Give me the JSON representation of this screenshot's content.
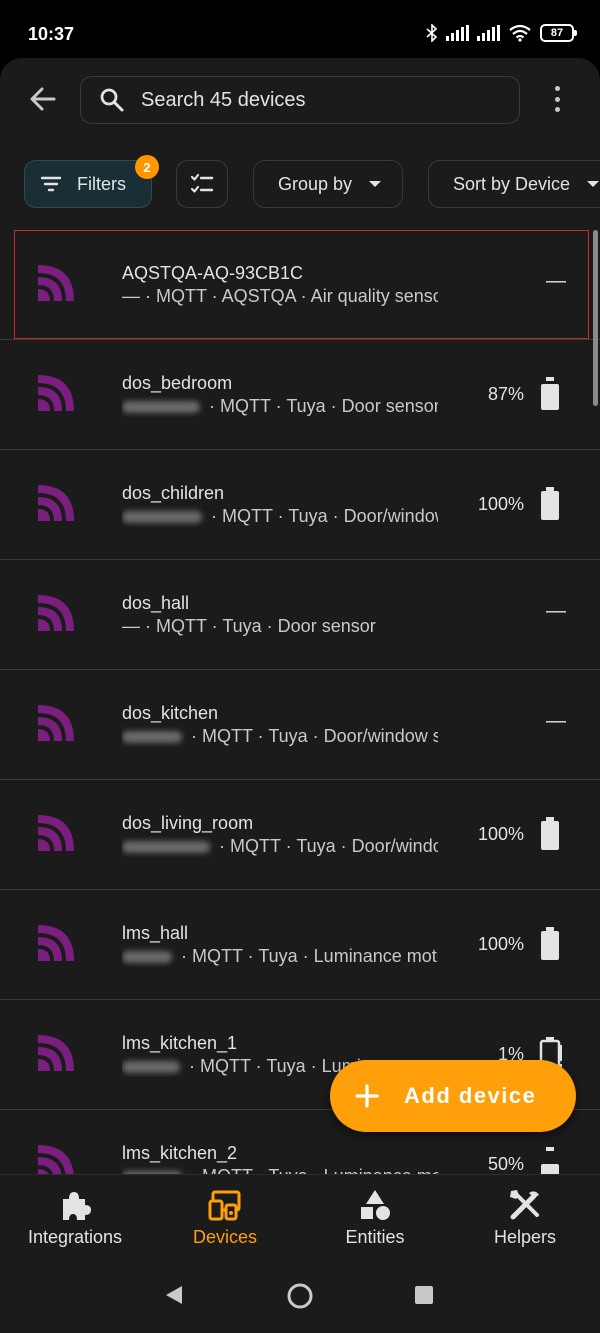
{
  "status_bar": {
    "time": "10:37",
    "battery": "87"
  },
  "topbar": {
    "search_placeholder": "Search 45 devices"
  },
  "toolbar": {
    "filters_label": "Filters",
    "filters_badge": "2",
    "group_by_label": "Group by",
    "sort_label": "Sort by Device"
  },
  "devices": [
    {
      "name": "AQSTQA-AQ-93CB1C",
      "area": "—",
      "meta": " · MQTT · AQSTQA · Air quality sensor",
      "battery": "—",
      "selected": true,
      "blurred": false
    },
    {
      "name": "dos_bedroom",
      "area": "",
      "meta": " · MQTT · Tuya · Door sensor",
      "battery": "87%",
      "battery_level": 87,
      "blurred": true
    },
    {
      "name": "dos_children",
      "area": "",
      "meta": " · MQTT · Tuya · Door/window sensor",
      "battery": "100%",
      "battery_level": 100,
      "blurred": true
    },
    {
      "name": "dos_hall",
      "area": "—",
      "meta": " · MQTT · Tuya · Door sensor",
      "battery": "—",
      "blurred": false
    },
    {
      "name": "dos_kitchen",
      "area": "",
      "meta": " · MQTT · Tuya · Door/window sensor",
      "battery": "—",
      "blurred": true
    },
    {
      "name": "dos_living_room",
      "area": "",
      "meta": " · MQTT · Tuya · Door/window sensor",
      "battery": "100%",
      "battery_level": 100,
      "blurred": true
    },
    {
      "name": "lms_hall",
      "area": "",
      "meta": " · MQTT · Tuya · Luminance motion sensor",
      "battery": "100%",
      "battery_level": 100,
      "blurred": true
    },
    {
      "name": "lms_kitchen_1",
      "area": "",
      "meta": " · MQTT · Tuya · Luminance motion sensor",
      "battery": "1%",
      "battery_level": 1,
      "blurred": true
    },
    {
      "name": "lms_kitchen_2",
      "area": "",
      "meta": " · MQTT · Tuya · Luminance motion sensor",
      "battery": "50%",
      "battery_level": 50,
      "blurred": true
    }
  ],
  "fab": {
    "label": "Add device"
  },
  "bottom_nav": [
    {
      "label": "Integrations",
      "icon": "puzzle-icon"
    },
    {
      "label": "Devices",
      "icon": "devices-icon",
      "active": true
    },
    {
      "label": "Entities",
      "icon": "shapes-icon"
    },
    {
      "label": "Helpers",
      "icon": "tools-icon"
    }
  ],
  "colors": {
    "accent": "#ffa00a",
    "device_icon": "#7a1f7f",
    "background": "#1c1b1b"
  }
}
